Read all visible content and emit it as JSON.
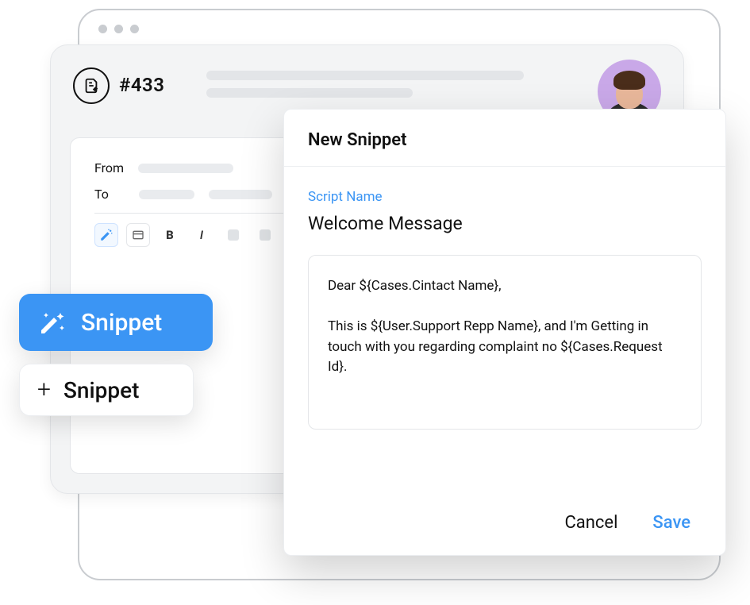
{
  "case": {
    "id": "#433"
  },
  "compose": {
    "from_label": "From",
    "to_label": "To"
  },
  "chips": {
    "snippet_active": "Snippet",
    "snippet_add": "Snippet"
  },
  "modal": {
    "title": "New Snippet",
    "script_name_label": "Script Name",
    "script_name_value": "Welcome Message",
    "body": "Dear ${Cases.Cintact Name},\n\nThis is ${User.Support Repp Name}, and I'm Getting in touch with you regarding complaint no ${Cases.Request Id}.",
    "cancel": "Cancel",
    "save": "Save"
  }
}
